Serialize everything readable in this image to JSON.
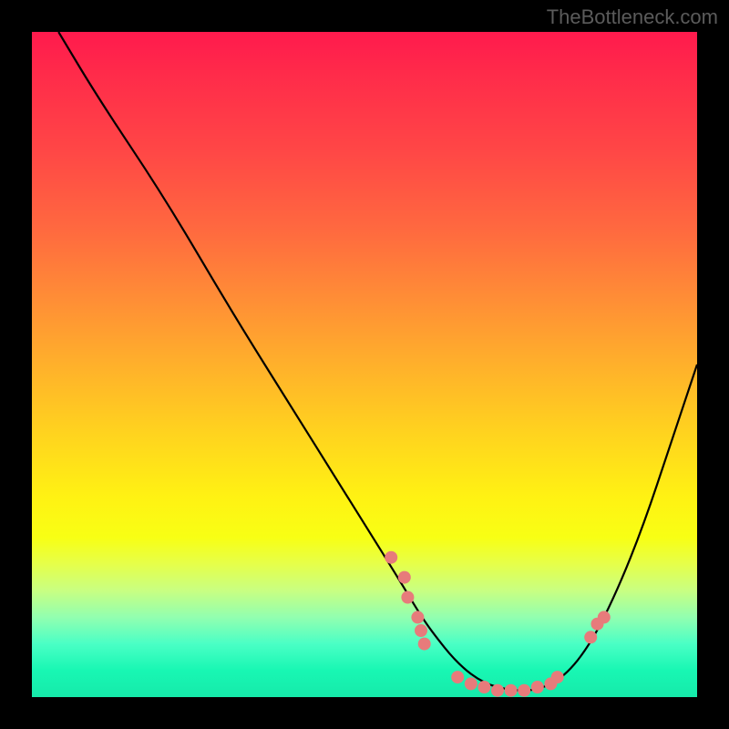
{
  "watermark": "TheBottleneck.com",
  "chart_data": {
    "type": "line",
    "title": "",
    "xlabel": "",
    "ylabel": "",
    "xlim": [
      0,
      100
    ],
    "ylim": [
      0,
      100
    ],
    "grid": false,
    "legend": false,
    "series": [
      {
        "name": "bottleneck-curve",
        "x": [
          4,
          10,
          20,
          30,
          40,
          45,
          50,
          55,
          58,
          60,
          64,
          68,
          72,
          76,
          80,
          84,
          88,
          92,
          96,
          100
        ],
        "y": [
          100,
          90,
          75,
          58,
          42,
          34,
          26,
          18,
          13,
          10,
          5,
          2,
          1,
          1,
          3,
          8,
          16,
          26,
          38,
          50
        ]
      }
    ],
    "scatter_points": {
      "name": "highlighted-points",
      "color": "#e77b7b",
      "points": [
        {
          "x": 54,
          "y": 21
        },
        {
          "x": 56,
          "y": 18
        },
        {
          "x": 56.5,
          "y": 15
        },
        {
          "x": 58,
          "y": 12
        },
        {
          "x": 58.5,
          "y": 10
        },
        {
          "x": 59,
          "y": 8
        },
        {
          "x": 64,
          "y": 3
        },
        {
          "x": 66,
          "y": 2
        },
        {
          "x": 68,
          "y": 1.5
        },
        {
          "x": 70,
          "y": 1
        },
        {
          "x": 72,
          "y": 1
        },
        {
          "x": 74,
          "y": 1
        },
        {
          "x": 76,
          "y": 1.5
        },
        {
          "x": 78,
          "y": 2
        },
        {
          "x": 79,
          "y": 3
        },
        {
          "x": 84,
          "y": 9
        },
        {
          "x": 85,
          "y": 11
        },
        {
          "x": 86,
          "y": 12
        }
      ]
    },
    "gradient_meaning": "vertical color gradient from red (high bottleneck) at top to green (optimal) at bottom"
  }
}
